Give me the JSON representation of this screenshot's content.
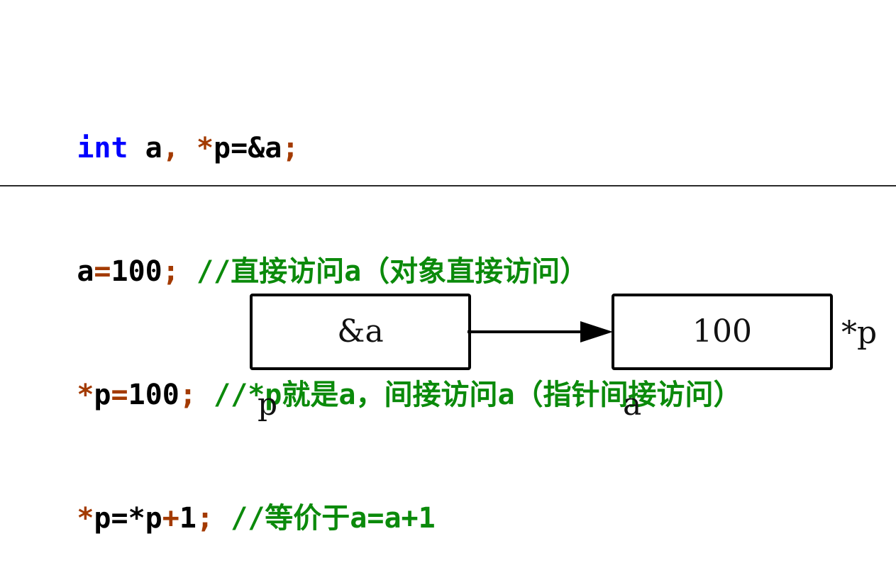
{
  "code": {
    "lines": [
      {
        "tokens": [
          {
            "text": "int",
            "kind": "kw"
          },
          {
            "text": " a",
            "kind": "plain"
          },
          {
            "text": ",",
            "kind": "op"
          },
          {
            "text": " ",
            "kind": "plain"
          },
          {
            "text": "*",
            "kind": "op"
          },
          {
            "text": "p=&a",
            "kind": "plain"
          },
          {
            "text": ";",
            "kind": "op"
          }
        ]
      },
      {
        "tokens": [
          {
            "text": "a",
            "kind": "plain"
          },
          {
            "text": "=",
            "kind": "op"
          },
          {
            "text": "100",
            "kind": "plain"
          },
          {
            "text": ";",
            "kind": "op"
          },
          {
            "text": " //直接访问a（对象直接访问）",
            "kind": "cm"
          }
        ]
      },
      {
        "tokens": [
          {
            "text": "*",
            "kind": "op"
          },
          {
            "text": "p",
            "kind": "plain"
          },
          {
            "text": "=",
            "kind": "op"
          },
          {
            "text": "100",
            "kind": "plain"
          },
          {
            "text": ";",
            "kind": "op"
          },
          {
            "text": " //*p就是a，间接访问a（指针间接访问）",
            "kind": "cm"
          }
        ]
      },
      {
        "tokens": [
          {
            "text": "*",
            "kind": "op"
          },
          {
            "text": "p=*p",
            "kind": "plain"
          },
          {
            "text": "+",
            "kind": "op"
          },
          {
            "text": "1",
            "kind": "plain"
          },
          {
            "text": ";",
            "kind": "op"
          },
          {
            "text": " //等价于a=a+1",
            "kind": "cm"
          }
        ]
      }
    ],
    "colors": {
      "kw": "#0000ff",
      "op": "#a33a00",
      "cm": "#0b8a0b",
      "plain": "#000000"
    }
  },
  "diagram": {
    "pointer_box": {
      "value": "&a",
      "name_label": "p"
    },
    "target_box": {
      "value": "100",
      "name_label": "a",
      "alias_label": "*p"
    },
    "arrow": {
      "from": "pointer_box",
      "to": "target_box"
    }
  }
}
